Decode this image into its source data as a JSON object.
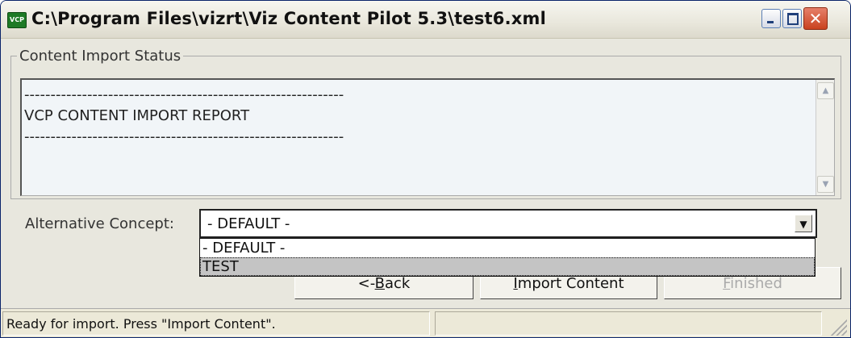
{
  "window": {
    "title": "C:\\Program Files\\vizrt\\Viz Content Pilot 5.3\\test6.xml",
    "app_icon_text": "VCP",
    "close_symbol": "✕"
  },
  "status_group": {
    "legend": "Content Import Status",
    "report_text": "-------------------------------------------------------------\nVCP CONTENT IMPORT REPORT\n-------------------------------------------------------------"
  },
  "alternative_concept": {
    "label": "Alternative Concept:",
    "selected": "- DEFAULT -",
    "options": [
      "- DEFAULT -",
      "TEST"
    ],
    "highlighted": "TEST"
  },
  "buttons": {
    "back": {
      "pre": "<-",
      "mnemonic": "B",
      "post": "ack"
    },
    "import": {
      "pre": "",
      "mnemonic": "I",
      "post": "mport Content"
    },
    "finished": {
      "pre": "",
      "mnemonic": "F",
      "post": "inished"
    }
  },
  "statusbar": {
    "text": "Ready for import. Press \"Import Content\"."
  },
  "icons": [
    "minimize-icon",
    "maximize-icon",
    "close-icon",
    "scroll-up-icon",
    "scroll-down-icon",
    "dropdown-arrow-icon",
    "size-grip-icon"
  ]
}
